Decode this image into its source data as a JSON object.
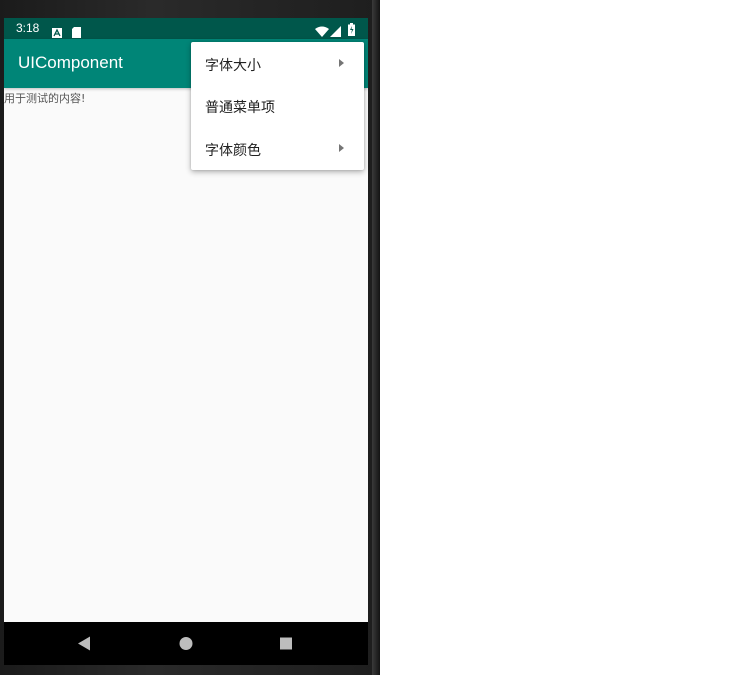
{
  "status_bar": {
    "time": "3:18",
    "icons": [
      "a-notification-icon",
      "sd-card-icon",
      "wifi-icon",
      "signal-icon",
      "battery-icon"
    ]
  },
  "app_bar": {
    "title": "UIComponent"
  },
  "content": {
    "text": "用于测试的内容!"
  },
  "popup_menu": {
    "items": [
      {
        "label": "字体大小",
        "has_submenu": true
      },
      {
        "label": "普通菜单项",
        "has_submenu": false
      },
      {
        "label": "字体颜色",
        "has_submenu": true
      }
    ]
  },
  "nav_bar": {
    "icons": [
      "back-icon",
      "home-icon",
      "recents-icon"
    ]
  },
  "colors": {
    "status_bar": "#00574b",
    "app_bar": "#008577",
    "screen_bg": "#fafafa"
  }
}
